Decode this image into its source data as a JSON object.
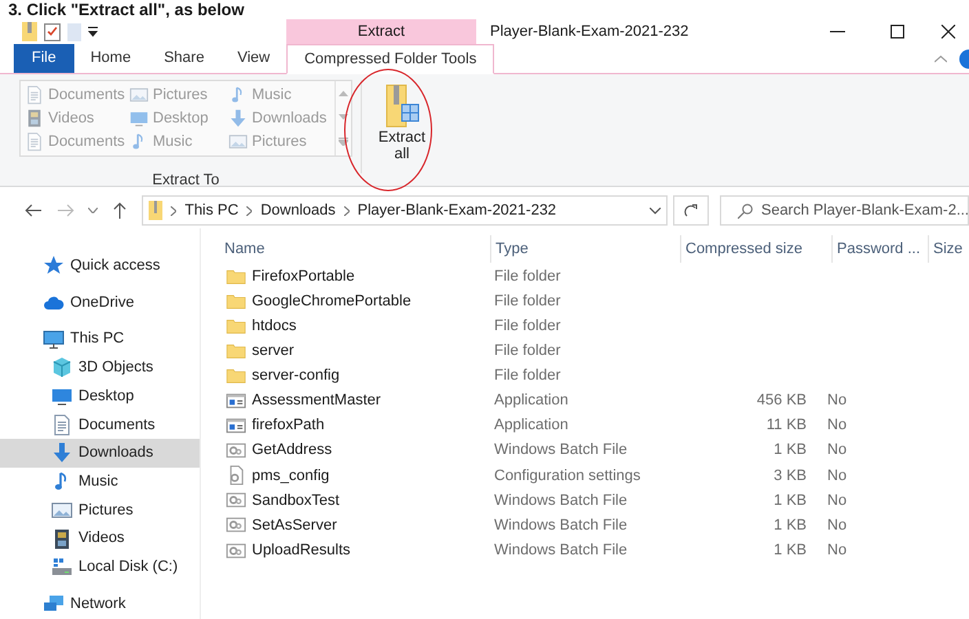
{
  "caption": "3. Click \"Extract all\", as below",
  "title_bar": {
    "contextual_tab": "Extract",
    "title": "Player-Blank-Exam-2021-232"
  },
  "ribbon_tabs": [
    {
      "label": "File",
      "kind": "file",
      "selected": false
    },
    {
      "label": "Home",
      "kind": "tab",
      "selected": false
    },
    {
      "label": "Share",
      "kind": "tab",
      "selected": false
    },
    {
      "label": "View",
      "kind": "tab",
      "selected": false
    },
    {
      "label": "Compressed Folder Tools",
      "kind": "tab",
      "selected": true
    }
  ],
  "ribbon": {
    "gallery": {
      "disabled": true,
      "items": [
        {
          "label": "Documents",
          "kind": "document"
        },
        {
          "label": "Pictures",
          "kind": "picture"
        },
        {
          "label": "Music",
          "kind": "music"
        },
        {
          "label": "Videos",
          "kind": "video"
        },
        {
          "label": "Desktop",
          "kind": "desktop"
        },
        {
          "label": "Downloads",
          "kind": "download"
        },
        {
          "label": "Documents",
          "kind": "document"
        },
        {
          "label": "Music",
          "kind": "music"
        },
        {
          "label": "Pictures",
          "kind": "picture"
        }
      ]
    },
    "extract_all": "Extract all",
    "group_label": "Extract To"
  },
  "address": {
    "segments": [
      "This PC",
      "Downloads",
      "Player-Blank-Exam-2021-232"
    ]
  },
  "search": {
    "placeholder": "Search Player-Blank-Exam-2..."
  },
  "navigation": [
    {
      "label": "Quick access",
      "kind": "star",
      "selected": false
    },
    {
      "label": "OneDrive",
      "kind": "cloud",
      "selected": false
    },
    {
      "label": "This PC",
      "kind": "pc",
      "selected": false,
      "children": [
        {
          "label": "3D Objects",
          "kind": "cube",
          "selected": false
        },
        {
          "label": "Desktop",
          "kind": "desktop",
          "selected": false
        },
        {
          "label": "Documents",
          "kind": "document",
          "selected": false
        },
        {
          "label": "Downloads",
          "kind": "download",
          "selected": true
        },
        {
          "label": "Music",
          "kind": "music",
          "selected": false
        },
        {
          "label": "Pictures",
          "kind": "picture",
          "selected": false
        },
        {
          "label": "Videos",
          "kind": "video",
          "selected": false
        },
        {
          "label": "Local Disk (C:)",
          "kind": "drive",
          "selected": false
        }
      ]
    },
    {
      "label": "Network",
      "kind": "network",
      "selected": false
    }
  ],
  "columns": [
    "Name",
    "Type",
    "Compressed size",
    "Password ...",
    "Size"
  ],
  "files": [
    {
      "name": "FirefoxPortable",
      "kind": "folder",
      "type": "File folder"
    },
    {
      "name": "GoogleChromePortable",
      "kind": "folder",
      "type": "File folder"
    },
    {
      "name": "htdocs",
      "kind": "folder",
      "type": "File folder"
    },
    {
      "name": "server",
      "kind": "folder",
      "type": "File folder"
    },
    {
      "name": "server-config",
      "kind": "folder",
      "type": "File folder"
    },
    {
      "name": "AssessmentMaster",
      "kind": "app",
      "type": "Application",
      "compressed_size": "456 KB",
      "password": "No"
    },
    {
      "name": "firefoxPath",
      "kind": "app",
      "type": "Application",
      "compressed_size": "11 KB",
      "password": "No"
    },
    {
      "name": "GetAddress",
      "kind": "batch",
      "type": "Windows Batch File",
      "compressed_size": "1 KB",
      "password": "No"
    },
    {
      "name": "pms_config",
      "kind": "config",
      "type": "Configuration settings",
      "compressed_size": "3 KB",
      "password": "No"
    },
    {
      "name": "SandboxTest",
      "kind": "batch",
      "type": "Windows Batch File",
      "compressed_size": "1 KB",
      "password": "No"
    },
    {
      "name": "SetAsServer",
      "kind": "batch",
      "type": "Windows Batch File",
      "compressed_size": "1 KB",
      "password": "No"
    },
    {
      "name": "UploadResults",
      "kind": "batch",
      "type": "Windows Batch File",
      "compressed_size": "1 KB",
      "password": "No"
    }
  ]
}
